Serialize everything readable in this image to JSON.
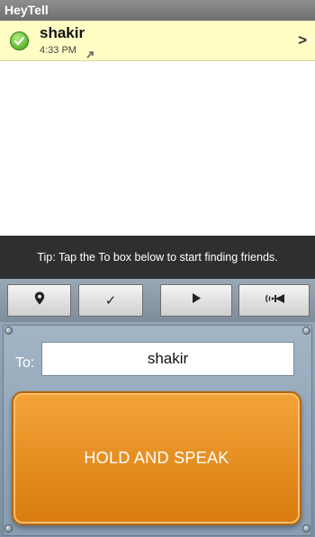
{
  "app": {
    "title": "HeyTell"
  },
  "conversation": {
    "name": "shakir",
    "time": "4:33 PM",
    "status_icon": "check-icon",
    "direction_icon": "outgoing-arrow-icon",
    "open_icon": ">"
  },
  "tip": {
    "text": "Tip: Tap the To box below to start finding friends."
  },
  "toolbar": {
    "buttons": [
      {
        "icon": "location-pin-icon"
      },
      {
        "icon": "checkmark-icon",
        "glyph": "✓"
      },
      {
        "icon": "play-icon"
      },
      {
        "icon": "broadcast-icon"
      }
    ]
  },
  "compose": {
    "to_label": "To:",
    "to_value": "shakir",
    "speak_label": "HOLD AND SPEAK"
  },
  "colors": {
    "title_bar": "#7f7f7f",
    "conversation_bg": "#fffdc4",
    "tip_bg": "#2f2f2f",
    "speak_orange": "#e8901f",
    "panel_blue": "#889db1"
  }
}
